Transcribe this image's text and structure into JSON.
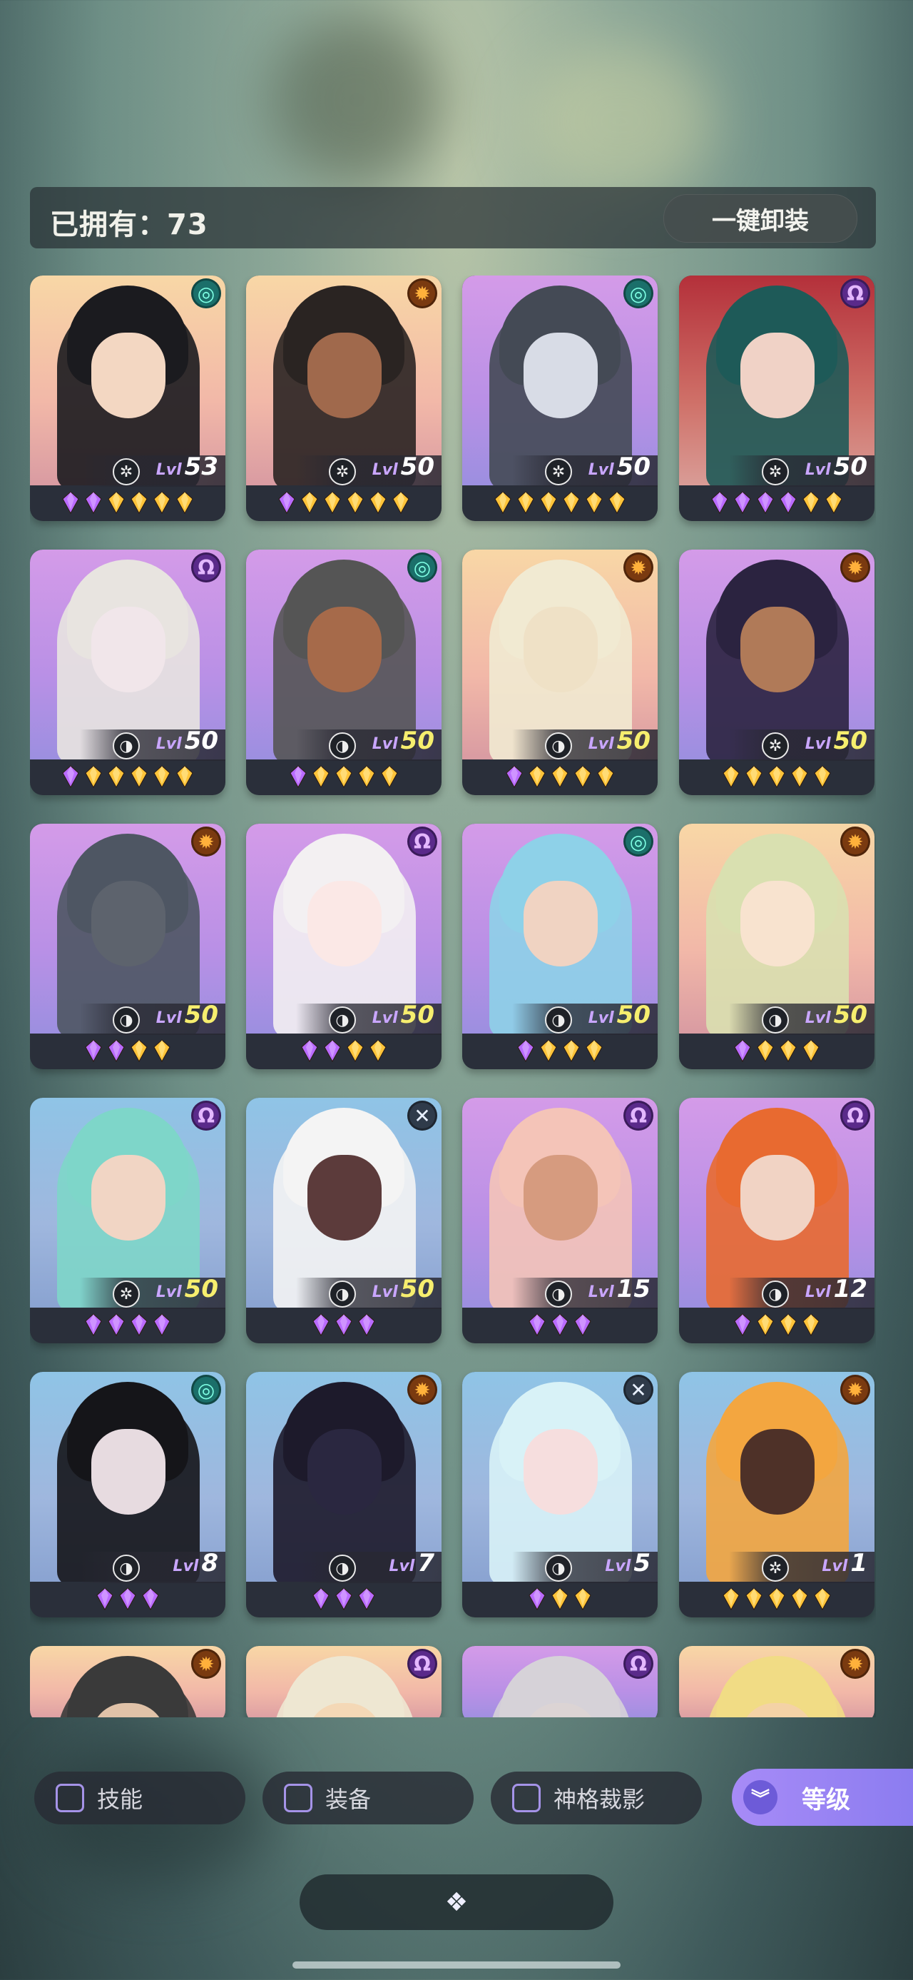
{
  "header": {
    "owned_label": "已拥有：73",
    "unequip_label": "一键卸装"
  },
  "faction_icons": {
    "green": "swirl-icon",
    "orange": "sun-icon",
    "purple": "omega-icon",
    "blue": "cross-icon"
  },
  "cards": [
    {
      "lvl": "53",
      "faction": "green",
      "bg": "orange",
      "gems": [
        "p",
        "p",
        "g",
        "g",
        "g",
        "g"
      ],
      "gold": false,
      "class": "wheel"
    },
    {
      "lvl": "50",
      "faction": "orange",
      "bg": "orange",
      "gems": [
        "p",
        "g",
        "g",
        "g",
        "g",
        "g"
      ],
      "gold": false,
      "class": "wheel"
    },
    {
      "lvl": "50",
      "faction": "green",
      "bg": "purple",
      "gems": [
        "g",
        "g",
        "g",
        "g",
        "g",
        "g"
      ],
      "gold": false,
      "class": "wheel"
    },
    {
      "lvl": "50",
      "faction": "purple",
      "bg": "red",
      "gems": [
        "p",
        "p",
        "p",
        "p",
        "g",
        "g"
      ],
      "gold": false,
      "class": "wheel"
    },
    {
      "lvl": "50",
      "faction": "purple",
      "bg": "purple",
      "gems": [
        "p",
        "g",
        "g",
        "g",
        "g",
        "g"
      ],
      "gold": false,
      "class": "moon"
    },
    {
      "lvl": "50",
      "faction": "green",
      "bg": "purple",
      "gems": [
        "p",
        "g",
        "g",
        "g",
        "g"
      ],
      "gold": true,
      "class": "moon"
    },
    {
      "lvl": "50",
      "faction": "orange",
      "bg": "orange",
      "gems": [
        "p",
        "g",
        "g",
        "g",
        "g"
      ],
      "gold": true,
      "class": "moon"
    },
    {
      "lvl": "50",
      "faction": "orange",
      "bg": "purple",
      "gems": [
        "g",
        "g",
        "g",
        "g",
        "g"
      ],
      "gold": true,
      "class": "wheel"
    },
    {
      "lvl": "50",
      "faction": "orange",
      "bg": "purple",
      "gems": [
        "p",
        "p",
        "g",
        "g"
      ],
      "gold": true,
      "class": "moon"
    },
    {
      "lvl": "50",
      "faction": "purple",
      "bg": "purple",
      "gems": [
        "p",
        "p",
        "g",
        "g"
      ],
      "gold": true,
      "class": "moon"
    },
    {
      "lvl": "50",
      "faction": "green",
      "bg": "purple",
      "gems": [
        "p",
        "g",
        "g",
        "g"
      ],
      "gold": true,
      "class": "moon"
    },
    {
      "lvl": "50",
      "faction": "orange",
      "bg": "orange",
      "gems": [
        "p",
        "g",
        "g",
        "g"
      ],
      "gold": true,
      "class": "moon"
    },
    {
      "lvl": "50",
      "faction": "purple",
      "bg": "blue",
      "gems": [
        "p",
        "p",
        "p",
        "p"
      ],
      "gold": true,
      "class": "wheel"
    },
    {
      "lvl": "50",
      "faction": "blue",
      "bg": "blue",
      "gems": [
        "p",
        "p",
        "p"
      ],
      "gold": true,
      "class": "moon"
    },
    {
      "lvl": "15",
      "faction": "purple",
      "bg": "purple",
      "gems": [
        "p",
        "p",
        "p"
      ],
      "gold": false,
      "class": "moon"
    },
    {
      "lvl": "12",
      "faction": "purple",
      "bg": "purple",
      "gems": [
        "p",
        "g",
        "g",
        "g"
      ],
      "gold": false,
      "class": "moon"
    },
    {
      "lvl": "8",
      "faction": "green",
      "bg": "blue",
      "gems": [
        "p",
        "p",
        "p"
      ],
      "gold": false,
      "class": "moon"
    },
    {
      "lvl": "7",
      "faction": "orange",
      "bg": "blue",
      "gems": [
        "p",
        "p",
        "p"
      ],
      "gold": false,
      "class": "moon"
    },
    {
      "lvl": "5",
      "faction": "blue",
      "bg": "blue",
      "gems": [
        "p",
        "g",
        "g"
      ],
      "gold": false,
      "class": "moon"
    },
    {
      "lvl": "1",
      "faction": "orange",
      "bg": "blue",
      "gems": [
        "g",
        "g",
        "g",
        "g",
        "g"
      ],
      "gold": false,
      "class": "wheel"
    },
    {
      "lvl": "",
      "faction": "orange",
      "bg": "orange",
      "gems": [],
      "gold": false,
      "partial": true
    },
    {
      "lvl": "",
      "faction": "purple",
      "bg": "orange",
      "gems": [],
      "gold": false,
      "partial": true
    },
    {
      "lvl": "",
      "faction": "purple",
      "bg": "purple",
      "gems": [],
      "gold": false,
      "partial": true
    },
    {
      "lvl": "",
      "faction": "orange",
      "bg": "orange",
      "gems": [],
      "gold": false,
      "partial": true
    }
  ],
  "lvl_prefix": "Lvl",
  "filters": [
    {
      "label": "技能",
      "key": "skill"
    },
    {
      "label": "装备",
      "key": "equip"
    },
    {
      "label": "神格裁影",
      "key": "divinity"
    }
  ],
  "sort_button": {
    "label": "等级",
    "icon": "double-chevron-down-icon"
  },
  "bottom_bar": {
    "icon": "diamond-cluster-icon"
  }
}
